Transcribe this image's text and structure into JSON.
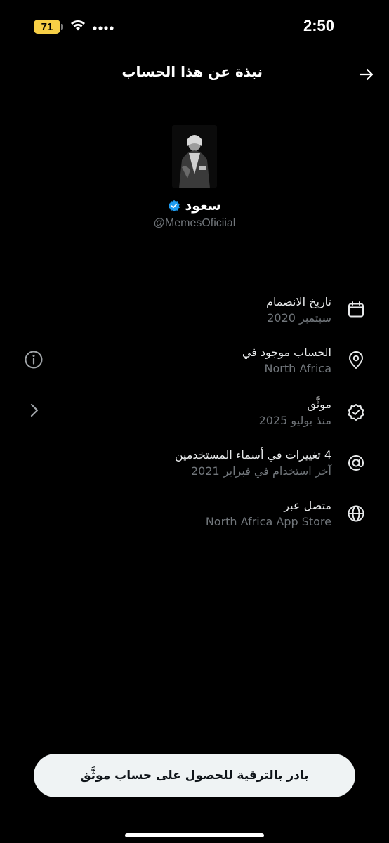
{
  "status_bar": {
    "battery": "71",
    "time": "2:50",
    "icons": [
      "battery-icon",
      "wifi-icon",
      "signal-icon"
    ]
  },
  "header": {
    "title": "نبذة عن هذا الحساب",
    "back_icon": "arrow-right-icon"
  },
  "profile": {
    "display_name": "سعود",
    "handle": "@MemesOficiial",
    "verified": true,
    "verified_color": "#1d9bf0"
  },
  "info": [
    {
      "icon": "calendar-icon",
      "label": "تاريخ الانضمام",
      "value": "سبتمبر 2020"
    },
    {
      "icon": "location-pin-icon",
      "label": "الحساب موجود في",
      "value": "North Africa"
    },
    {
      "icon": "verified-badge-icon",
      "label": "موثَّق",
      "value": "منذ يوليو 2025"
    },
    {
      "icon": "at-sign-icon",
      "label": "4 تغييرات في أسماء المستخدمين",
      "value": "آخر استخدام في فبراير 2021"
    },
    {
      "icon": "globe-icon",
      "label": "متصل عبر",
      "value": "North Africa App Store"
    }
  ],
  "side_controls": {
    "info_icon": "info-circle-icon",
    "chevron_icon": "chevron-right-icon"
  },
  "cta": {
    "label": "بادر بالترقية للحصول على حساب موثَّق"
  },
  "colors": {
    "background": "#000000",
    "primary_text": "#e7e9ea",
    "secondary_text": "#71767b",
    "button_bg": "#eff3f4",
    "battery": "#f7cf46"
  }
}
